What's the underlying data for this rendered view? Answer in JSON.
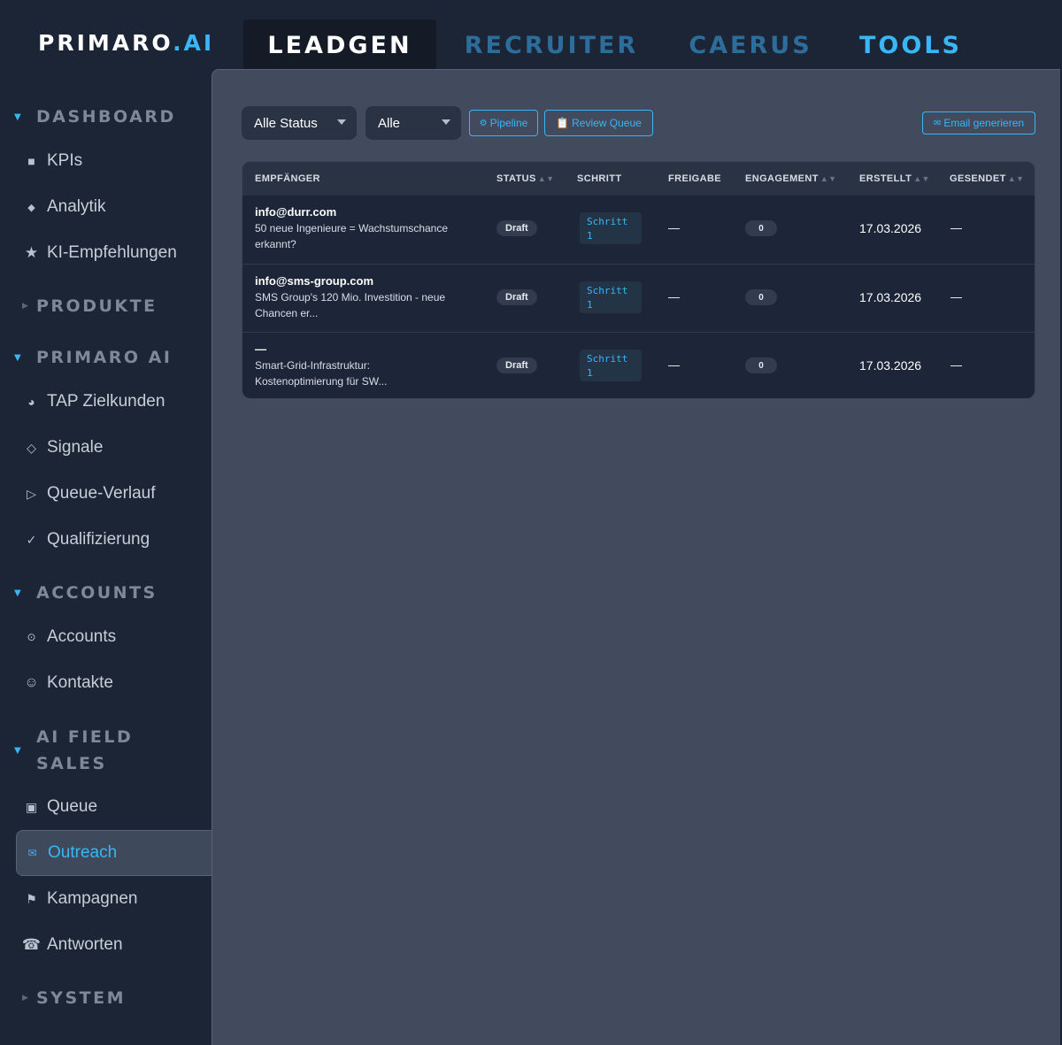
{
  "brand": {
    "name": "PRIMARO",
    "suffix": ".AI"
  },
  "top_tabs": [
    {
      "label": "LEADGEN",
      "active": true
    },
    {
      "label": "RECRUITER"
    },
    {
      "label": "CAERUS"
    },
    {
      "label": "TOOLS"
    }
  ],
  "sidebar": {
    "sections": [
      {
        "label": "DASHBOARD",
        "expanded": true
      },
      {
        "label": "PRODUKTE",
        "expanded": false
      },
      {
        "label": "PRIMARO AI",
        "expanded": true
      },
      {
        "label": "ACCOUNTS",
        "expanded": true
      },
      {
        "label": "AI FIELD SALES",
        "label_line1": "AI FIELD",
        "label_line2": "SALES",
        "expanded": true
      },
      {
        "label": "SYSTEM",
        "expanded": false
      }
    ],
    "items": [
      {
        "label": "KPIs",
        "icon": "square-icon",
        "glyph": "■"
      },
      {
        "label": "Analytik",
        "icon": "diamond-icon",
        "glyph": "◆"
      },
      {
        "label": "KI-Empfehlungen",
        "icon": "star-icon",
        "glyph": "★"
      },
      {
        "label": "TAP Zielkunden",
        "icon": "target-icon",
        "glyph": "◕"
      },
      {
        "label": "Signale",
        "icon": "diamond-outline-icon",
        "glyph": "◇"
      },
      {
        "label": "Queue-Verlauf",
        "icon": "play-icon",
        "glyph": "▷"
      },
      {
        "label": "Qualifizierung",
        "icon": "check-icon",
        "glyph": "✓"
      },
      {
        "label": "Accounts",
        "icon": "circle-dot-icon",
        "glyph": "⊙"
      },
      {
        "label": "Kontakte",
        "icon": "smiley-icon",
        "glyph": "☺"
      },
      {
        "label": "Queue",
        "icon": "box-icon",
        "glyph": "▣"
      },
      {
        "label": "Outreach",
        "icon": "envelope-icon",
        "glyph": "✉",
        "active": true
      },
      {
        "label": "Kampagnen",
        "icon": "flag-icon",
        "glyph": "⚑"
      },
      {
        "label": "Antworten",
        "icon": "phone-icon",
        "glyph": "☎"
      }
    ]
  },
  "toolbar": {
    "status_filter": "Alle Status",
    "type_filter": "Alle",
    "pipeline_label": "Pipeline",
    "pipeline_glyph": "⚙",
    "review_label": "Review Queue",
    "review_glyph": "📋",
    "email_label": "Email generieren",
    "email_glyph": "✉"
  },
  "table": {
    "columns": [
      "EMPFÄNGER",
      "STATUS",
      "SCHRITT",
      "FREIGABE",
      "ENGAGEMENT",
      "ERSTELLT",
      "GESENDET"
    ],
    "sort_glyph": "▲▼",
    "rows": [
      {
        "recipient": "info@durr.com",
        "subject_line1": "50 neue Ingenieure = Wachstumschance",
        "subject_line2": "erkannt?",
        "status": "Draft",
        "step_line1": "Schritt",
        "step_line2": "1",
        "approval": "—",
        "engagement": "0",
        "created": "17.03.2026",
        "sent": "—"
      },
      {
        "recipient": "info@sms-group.com",
        "subject_line1": "SMS Group's 120 Mio. Investition - neue",
        "subject_line2": "Chancen er...",
        "status": "Draft",
        "step_line1": "Schritt",
        "step_line2": "1",
        "approval": "—",
        "engagement": "0",
        "created": "17.03.2026",
        "sent": "—"
      },
      {
        "recipient": "—",
        "subject_line1": "Smart-Grid-Infrastruktur:",
        "subject_line2": "Kostenoptimierung für SW...",
        "status": "Draft",
        "step_line1": "Schritt",
        "step_line2": "1",
        "approval": "—",
        "engagement": "0",
        "created": "17.03.2026",
        "sent": "—"
      }
    ]
  },
  "colors": {
    "accent": "#38b6f5",
    "tab_inactive": "#2d6d9c",
    "sidebar_bg": "#1c2535",
    "panel_bg": "#414b5d",
    "table_bg": "#1d2638"
  }
}
